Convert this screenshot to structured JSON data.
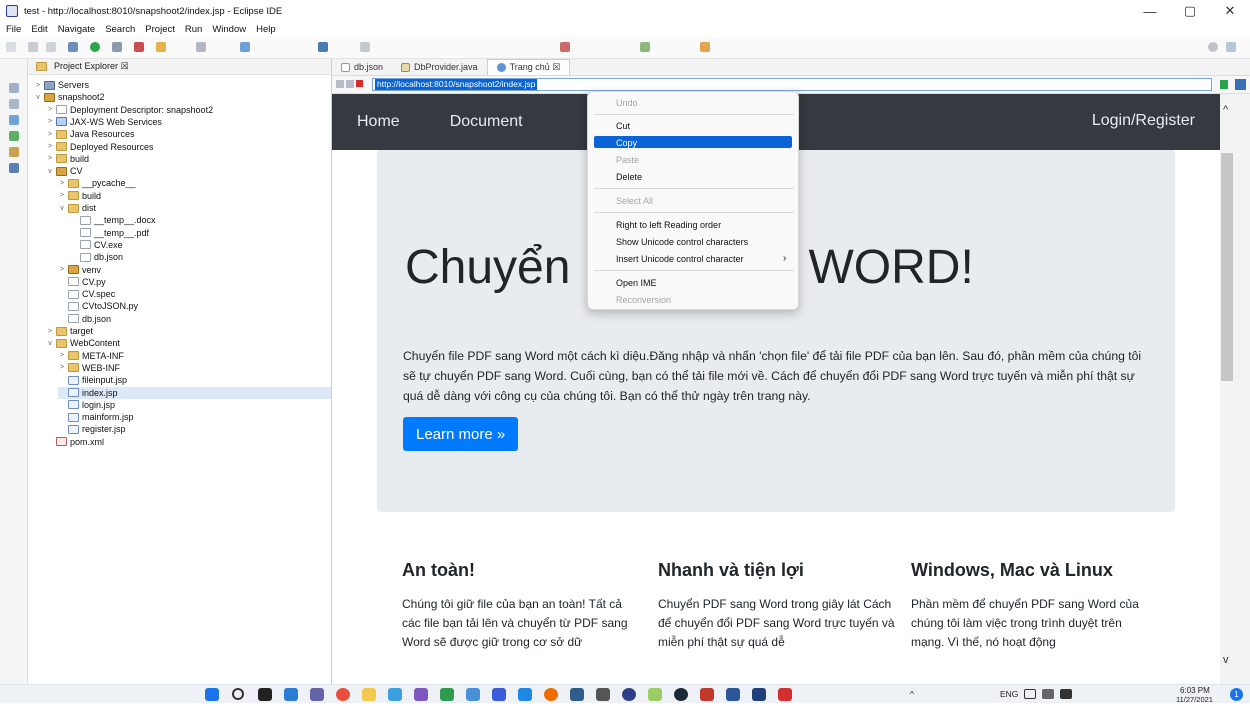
{
  "window": {
    "title": "test - http://localhost:8010/snapshoot2/index.jsp - Eclipse IDE",
    "minimize": "—",
    "maximize": "▢",
    "close": "✕"
  },
  "menu": [
    "File",
    "Edit",
    "Navigate",
    "Search",
    "Project",
    "Run",
    "Window",
    "Help"
  ],
  "explorer": {
    "title": "Project Explorer ☒",
    "items": [
      "Servers",
      "snapshoot2",
      "Deployment Descriptor: snapshoot2",
      "JAX-WS Web Services",
      "Java Resources",
      "Deployed Resources",
      "build",
      "CV",
      "__pycache__",
      "build",
      "dist",
      "__temp__.docx",
      "__temp__.pdf",
      "CV.exe",
      "db.json",
      "venv",
      "CV.py",
      "CV.spec",
      "CVtoJSON.py",
      "db.json",
      "target",
      "WebContent",
      "META-INF",
      "WEB-INF",
      "fileinput.jsp",
      "index.jsp",
      "login.jsp",
      "mainform.jsp",
      "register.jsp",
      "pom.xml"
    ]
  },
  "tabs": [
    "db.json",
    "DbProvider.java",
    "Trang chủ ☒"
  ],
  "url": "http://localhost:8010/snapshoot2/index.jsp",
  "site": {
    "nav": {
      "home": "Home",
      "document": "Document",
      "login": "Login/Register"
    },
    "hero_left": "Chuyển",
    "hero_right": "g WORD!",
    "hero_text": "Chuyển file PDF sang Word một cách kì diệu.Đăng nhập và nhấn 'chọn file' để tải file PDF của bạn lên. Sau đó, phần mềm của chúng tôi sẽ tự chuyển PDF sang Word. Cuối cùng, bạn có thể tải file mới về. Cách để chuyển đổi PDF sang Word trực tuyến và miễn phí thật sự quá dễ dàng với công cụ của chúng tôi. Bạn có thể thử ngày trên trang này.",
    "learn_more": "Learn more »",
    "col1": {
      "title": "An toàn!",
      "text": "Chúng tôi giữ file của bạn an toàn! Tất cả các file bạn tải lên và chuyển từ PDF sang Word sẽ được giữ trong cơ sở dữ"
    },
    "col2": {
      "title": "Nhanh và tiện lợi",
      "text": "Chuyển PDF sang Word trong giây lát Cách để chuyển đổi PDF sang Word trực tuyến và miễn phí thật sự quá dễ"
    },
    "col3": {
      "title": "Windows, Mac và Linux",
      "text": "Phần mềm để chuyển PDF sang Word của chúng tôi làm việc trong trình duyệt trên mạng. Vì thế, nó hoạt động"
    }
  },
  "context_menu": {
    "undo": "Undo",
    "cut": "Cut",
    "copy": "Copy",
    "paste": "Paste",
    "delete": "Delete",
    "select_all": "Select All",
    "rtl": "Right to left Reading order",
    "show_unicode": "Show Unicode control characters",
    "insert_unicode": "Insert Unicode control character",
    "open_ime": "Open IME",
    "reconversion": "Reconversion",
    "submenu_arrow": "›"
  },
  "tray": {
    "lang": "ENG",
    "time": "6:03 PM",
    "date": "11/27/2021",
    "notif": "1"
  },
  "colors": {
    "navbar": "#343a40",
    "jumbotron": "#e9ecef",
    "button": "#007bff",
    "selection": "#0a64d6"
  }
}
